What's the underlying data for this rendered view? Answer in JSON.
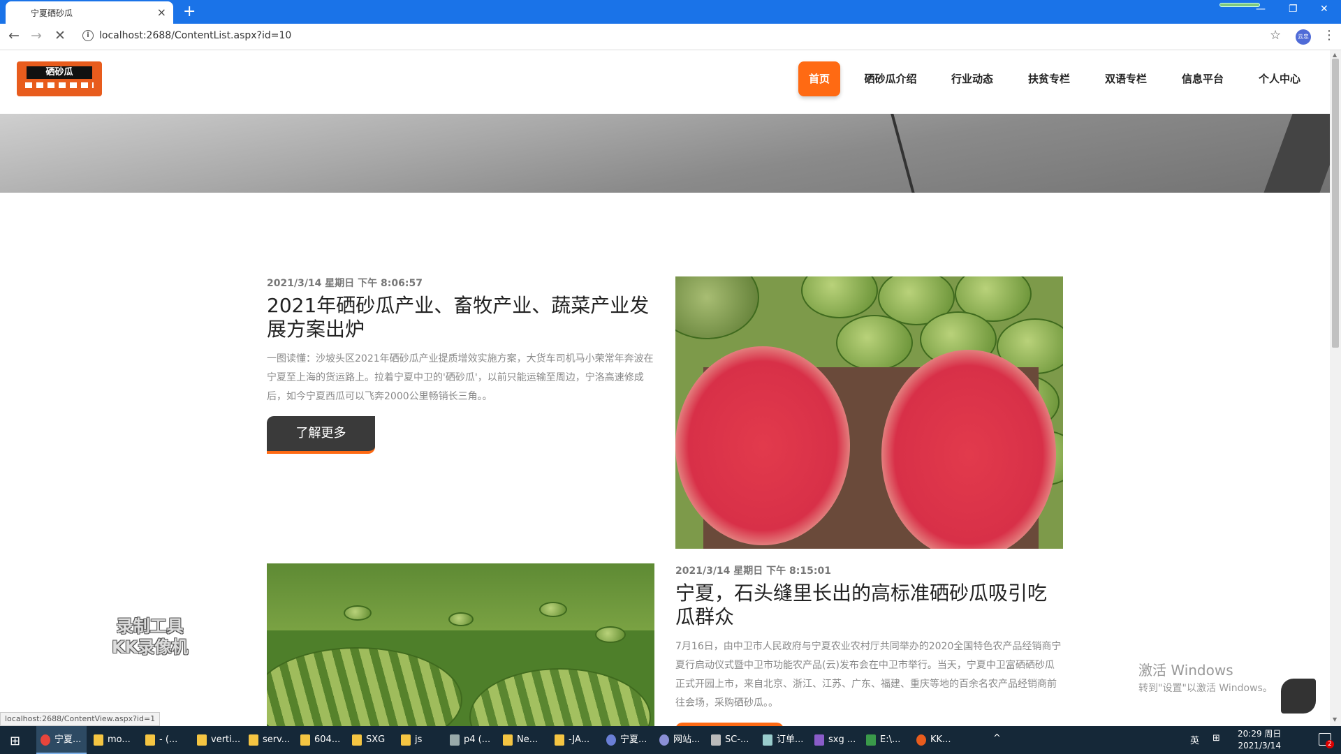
{
  "browser": {
    "tab_title": "宁夏硒砂瓜",
    "tab_close": "×",
    "new_tab": "+",
    "url": "localhost:2688/ContentList.aspx?id=10",
    "back": "←",
    "forward": "→",
    "reload": "✕",
    "info": "i",
    "star": "☆",
    "profile": "云忠",
    "menu": "⋮",
    "win_min": "—",
    "win_restore": "❐",
    "win_close": "✕",
    "status_url": "localhost:2688/ContentView.aspx?id=1"
  },
  "site": {
    "logo_text": "硒砂瓜",
    "nav": [
      "首页",
      "硒砂瓜介绍",
      "行业动态",
      "扶贫专栏",
      "双语专栏",
      "信息平台",
      "个人中心"
    ]
  },
  "articles": [
    {
      "date": "2021/3/14 星期日 下午 8:06:57",
      "title": "2021年硒砂瓜产业、畜牧产业、蔬菜产业发展方案出炉",
      "desc": "一图读懂：沙坡头区2021年硒砂瓜产业提质增效实施方案，大货车司机马小荣常年奔波在宁夏至上海的货运路上。拉着宁夏中卫的'硒砂瓜'，以前只能运输至周边，宁洛高速修成后，如今宁夏西瓜可以飞奔2000公里畅销长三角。。",
      "button": "了解更多"
    },
    {
      "date": "2021/3/14 星期日 下午 8:15:01",
      "title": "宁夏，石头缝里长出的高标准硒砂瓜吸引吃瓜群众",
      "desc": "7月16日，由中卫市人民政府与宁夏农业农村厅共同举办的2020全国特色农产品经销商宁夏行启动仪式暨中卫市功能农产品(云)发布会在中卫市举行。当天，宁夏中卫富硒硒砂瓜正式开园上市，来自北京、浙江、江苏、广东、福建、重庆等地的百余名农产品经销商前往会场，采购硒砂瓜。。"
    }
  ],
  "overlay": {
    "recorder_line1": "录制工具",
    "recorder_line2": "KK录像机",
    "activate_title": "激活 Windows",
    "activate_sub": "转到\"设置\"以激活 Windows。"
  },
  "taskbar": {
    "start": "⊞",
    "items": [
      "宁夏...",
      "mo...",
      "- (...",
      "verti...",
      "serv...",
      "604...",
      "SXG",
      "js",
      "p4 (...",
      "Ne...",
      "-JA...",
      "宁夏...",
      "网站...",
      "SC-...",
      "订单...",
      "sxg ...",
      "E:\\...",
      "KK..."
    ],
    "tray_up": "^",
    "ime": "英",
    "grid": "⊞",
    "time": "20:29 周日",
    "date": "2021/3/14",
    "notif_count": "2"
  },
  "colors": {
    "accent": "#ff6a13",
    "chrome_blue": "#1a73e8",
    "taskbar": "#152838"
  }
}
